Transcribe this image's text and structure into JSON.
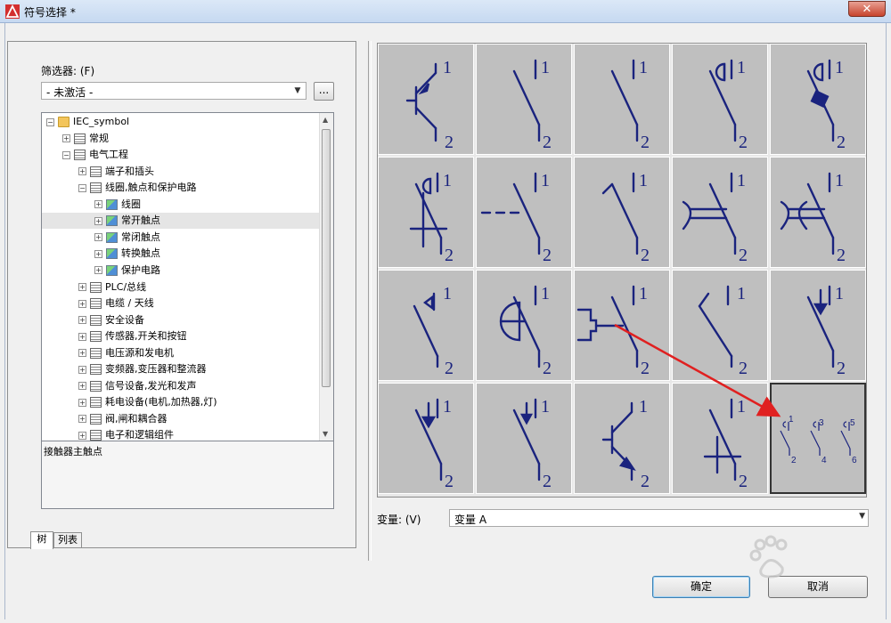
{
  "window": {
    "title": "符号选择 *",
    "close_glyph": "✕"
  },
  "filter": {
    "label": "筛选器: (F)",
    "value": "- 未激活 -",
    "browse_label": "..."
  },
  "tree": {
    "items": [
      {
        "label": "IEC_symbol",
        "expander": "−",
        "icon": "folder-icon",
        "indent": 0
      },
      {
        "label": "常规",
        "expander": "+",
        "icon": "group-icon",
        "indent": 1
      },
      {
        "label": "电气工程",
        "expander": "−",
        "icon": "group-icon",
        "indent": 1
      },
      {
        "label": "端子和插头",
        "expander": "+",
        "icon": "group-icon",
        "indent": 2
      },
      {
        "label": "线圈,触点和保护电路",
        "expander": "−",
        "icon": "group-icon",
        "indent": 2
      },
      {
        "label": "线圈",
        "expander": "+",
        "icon": "image-icon",
        "indent": 3
      },
      {
        "label": "常开触点",
        "expander": "+",
        "icon": "image-icon",
        "indent": 3,
        "selected": true
      },
      {
        "label": "常闭触点",
        "expander": "+",
        "icon": "image-icon",
        "indent": 3
      },
      {
        "label": "转换触点",
        "expander": "+",
        "icon": "image-icon",
        "indent": 3
      },
      {
        "label": "保护电路",
        "expander": "+",
        "icon": "image-icon",
        "indent": 3
      },
      {
        "label": "PLC/总线",
        "expander": "+",
        "icon": "group-icon",
        "indent": 2
      },
      {
        "label": "电缆 / 天线",
        "expander": "+",
        "icon": "group-icon",
        "indent": 2
      },
      {
        "label": "安全设备",
        "expander": "+",
        "icon": "group-icon",
        "indent": 2
      },
      {
        "label": "传感器,开关和按钮",
        "expander": "+",
        "icon": "group-icon",
        "indent": 2
      },
      {
        "label": "电压源和发电机",
        "expander": "+",
        "icon": "group-icon",
        "indent": 2
      },
      {
        "label": "变频器,变压器和整流器",
        "expander": "+",
        "icon": "group-icon",
        "indent": 2
      },
      {
        "label": "信号设备,发光和发声",
        "expander": "+",
        "icon": "group-icon",
        "indent": 2
      },
      {
        "label": "耗电设备(电机,加热器,灯)",
        "expander": "+",
        "icon": "group-icon",
        "indent": 2
      },
      {
        "label": "阀,闸和耦合器",
        "expander": "+",
        "icon": "group-icon",
        "indent": 2
      },
      {
        "label": "电子和逻辑组件",
        "expander": "+",
        "icon": "group-icon",
        "indent": 2
      }
    ],
    "scroll_up": "▲",
    "scroll_down": "▼"
  },
  "description": "接触器主触点",
  "tabs": [
    {
      "label": "树",
      "active": true
    },
    {
      "label": "列表",
      "active": false
    }
  ],
  "symbols": {
    "cells": [
      {
        "type": "transistor-pnp",
        "top": "1",
        "bottom": "2"
      },
      {
        "type": "no-contact",
        "top": "1",
        "bottom": "2"
      },
      {
        "type": "no-contact-plain",
        "top": "1",
        "bottom": "2"
      },
      {
        "type": "no-contact-half-circle",
        "top": "1",
        "bottom": "2"
      },
      {
        "type": "no-contact-block",
        "top": "1",
        "bottom": "2"
      },
      {
        "type": "no-contact-circle-mark",
        "top": "1",
        "bottom": "2"
      },
      {
        "type": "no-contact-dashed",
        "top": "1",
        "bottom": "2"
      },
      {
        "type": "no-contact-hook",
        "top": "1",
        "bottom": "2"
      },
      {
        "type": "no-contact-double-arc",
        "top": "1",
        "bottom": "2"
      },
      {
        "type": "no-contact-double-arc-x",
        "top": "1",
        "bottom": "2"
      },
      {
        "type": "no-contact-triangle",
        "top": "1",
        "bottom": "2"
      },
      {
        "type": "no-contact-semicircle-left",
        "top": "1",
        "bottom": "2"
      },
      {
        "type": "no-contact-pneumatic",
        "top": "1",
        "bottom": "2"
      },
      {
        "type": "no-contact-step",
        "top": "1",
        "bottom": "2"
      },
      {
        "type": "no-contact-arrow-down",
        "top": "1",
        "bottom": "2"
      },
      {
        "type": "no-contact-arrow-hook",
        "top": "1",
        "bottom": "2"
      },
      {
        "type": "no-contact-arrow-small",
        "top": "1",
        "bottom": "2"
      },
      {
        "type": "transistor-npn",
        "top": "1",
        "bottom": "2"
      },
      {
        "type": "no-contact-cross",
        "top": "1",
        "bottom": "2"
      },
      {
        "type": "contactor-main-3pole",
        "labels": [
          "1",
          "2",
          "3",
          "4",
          "5",
          "6"
        ],
        "selected": true
      }
    ]
  },
  "variant": {
    "label": "变量: (V)",
    "value": "变量 A"
  },
  "buttons": {
    "ok": "确定",
    "cancel": "取消"
  },
  "colors": {
    "symbol_stroke": "#1a237e",
    "cell_bg": "#bfbfbf",
    "annotation_arrow": "#e02020"
  }
}
